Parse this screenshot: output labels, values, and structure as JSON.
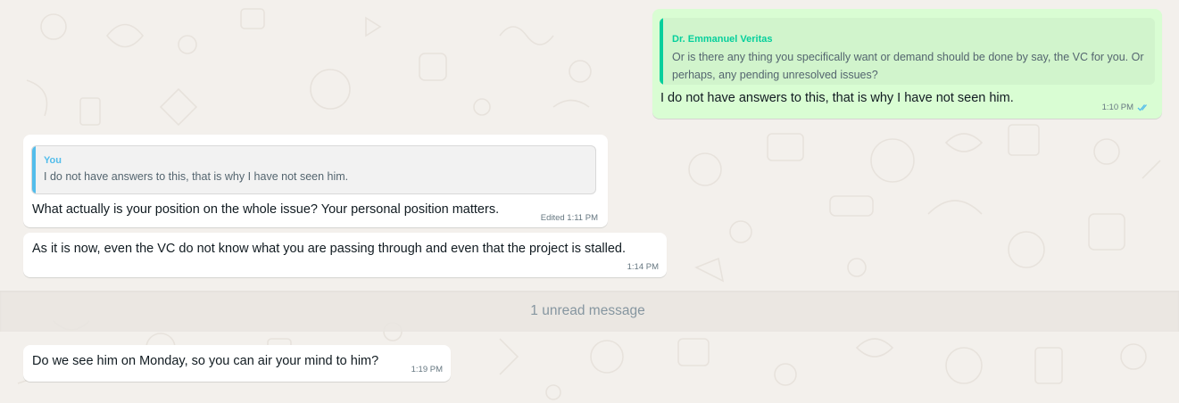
{
  "messages": [
    {
      "quote": {
        "author": "Dr. Emmanuel Veritas",
        "text_line1": "Or is there any thing you specifically want or demand should be done by say, the VC for you. Or",
        "text_line2": "perhaps, any pending unresolved issues?"
      },
      "text": "I do not have answers to this, that is why I have not seen him.",
      "time": "1:10 PM",
      "status": "read"
    },
    {
      "quote": {
        "author": "You",
        "text": "I do not have answers to this, that is why I have not seen him."
      },
      "text": "What actually is your position on the whole issue? Your personal position matters.",
      "time": "Edited 1:11 PM"
    },
    {
      "text": "As it is now, even the VC do not know what you are passing through and even that the project is stalled.",
      "time": "1:14 PM"
    },
    {
      "text": "Do we see him on Monday, so you can air your mind to him?",
      "time": "1:19 PM"
    }
  ],
  "unread_banner": "1 unread message",
  "colors": {
    "outgoing_bubble": "#d9fdd3",
    "incoming_bubble": "#ffffff",
    "quote_author_out": "#06cf9c",
    "quote_author_in": "#53bdeb",
    "read_ticks": "#53bdeb"
  },
  "icons": {
    "read_status": "double-check-icon"
  }
}
